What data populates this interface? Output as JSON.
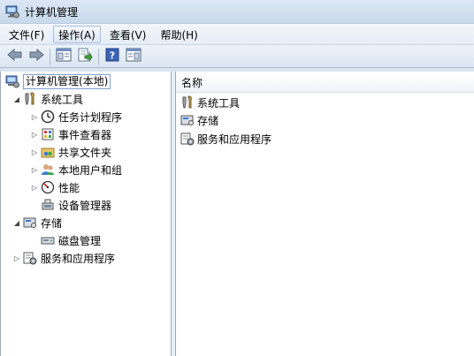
{
  "window": {
    "title": "计算机管理"
  },
  "menu": [
    {
      "label": "文件(F)",
      "active": false
    },
    {
      "label": "操作(A)",
      "active": true
    },
    {
      "label": "查看(V)",
      "active": false
    },
    {
      "label": "帮助(H)",
      "active": false
    }
  ],
  "toolbar": {
    "buttons": [
      "back-icon",
      "forward-icon",
      "show-hide-console-tree-icon",
      "export-list-icon",
      "help-icon",
      "show-hide-action-pane-icon"
    ]
  },
  "tree": {
    "root": "计算机管理(本地)",
    "system_tools": "系统工具",
    "task_scheduler": "任务计划程序",
    "event_viewer": "事件查看器",
    "shared_folders": "共享文件夹",
    "local_users_groups": "本地用户和组",
    "performance": "性能",
    "device_manager": "设备管理器",
    "storage": "存储",
    "disk_management": "磁盘管理",
    "services_apps": "服务和应用程序"
  },
  "list": {
    "column_name": "名称",
    "items": [
      "系统工具",
      "存储",
      "服务和应用程序"
    ]
  }
}
